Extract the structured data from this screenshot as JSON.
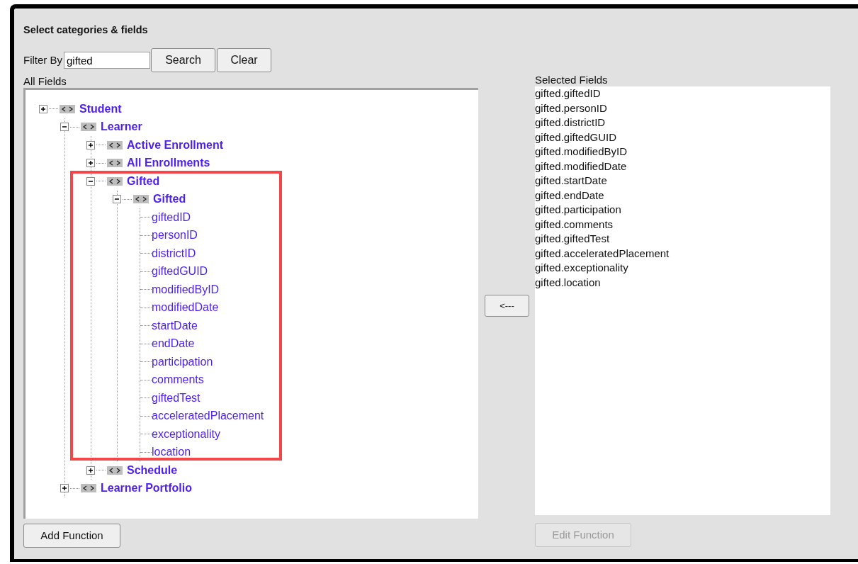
{
  "title": "Select categories & fields",
  "filter": {
    "label": "Filter By",
    "value": "gifted",
    "buttons": [
      "Search",
      "Clear"
    ]
  },
  "all_fields": {
    "label": "All Fields",
    "tree": [
      {
        "label": "Student",
        "kind": "category",
        "expanded": false,
        "children": [
          {
            "label": "Learner",
            "kind": "category",
            "expanded": true,
            "children": [
              {
                "label": "Active Enrollment",
                "kind": "category",
                "expanded": false
              },
              {
                "label": "All Enrollments",
                "kind": "category",
                "expanded": false
              },
              {
                "label": "Gifted",
                "kind": "category",
                "expanded": true,
                "children": [
                  {
                    "label": "Gifted",
                    "kind": "category",
                    "expanded": true,
                    "children": [
                      {
                        "label": "giftedID",
                        "kind": "field"
                      },
                      {
                        "label": "personID",
                        "kind": "field"
                      },
                      {
                        "label": "districtID",
                        "kind": "field"
                      },
                      {
                        "label": "giftedGUID",
                        "kind": "field"
                      },
                      {
                        "label": "modifiedByID",
                        "kind": "field"
                      },
                      {
                        "label": "modifiedDate",
                        "kind": "field"
                      },
                      {
                        "label": "startDate",
                        "kind": "field"
                      },
                      {
                        "label": "endDate",
                        "kind": "field"
                      },
                      {
                        "label": "participation",
                        "kind": "field"
                      },
                      {
                        "label": "comments",
                        "kind": "field"
                      },
                      {
                        "label": "giftedTest",
                        "kind": "field"
                      },
                      {
                        "label": "acceleratedPlacement",
                        "kind": "field"
                      },
                      {
                        "label": "exceptionality",
                        "kind": "field"
                      },
                      {
                        "label": "location",
                        "kind": "field"
                      }
                    ]
                  }
                ]
              },
              {
                "label": "Schedule",
                "kind": "category",
                "expanded": false
              }
            ]
          },
          {
            "label": "Learner Portfolio",
            "kind": "category",
            "expanded": false
          }
        ]
      }
    ]
  },
  "move_button": "<---",
  "selected_fields": {
    "label": "Selected Fields",
    "items": [
      "gifted.giftedID",
      "gifted.personID",
      "gifted.districtID",
      "gifted.giftedGUID",
      "gifted.modifiedByID",
      "gifted.modifiedDate",
      "gifted.startDate",
      "gifted.endDate",
      "gifted.participation",
      "gifted.comments",
      "gifted.giftedTest",
      "gifted.acceleratedPlacement",
      "gifted.exceptionality",
      "gifted.location"
    ]
  },
  "function_buttons": [
    {
      "label": "Add Function",
      "disabled": false
    },
    {
      "label": "Edit Function",
      "disabled": true
    }
  ]
}
